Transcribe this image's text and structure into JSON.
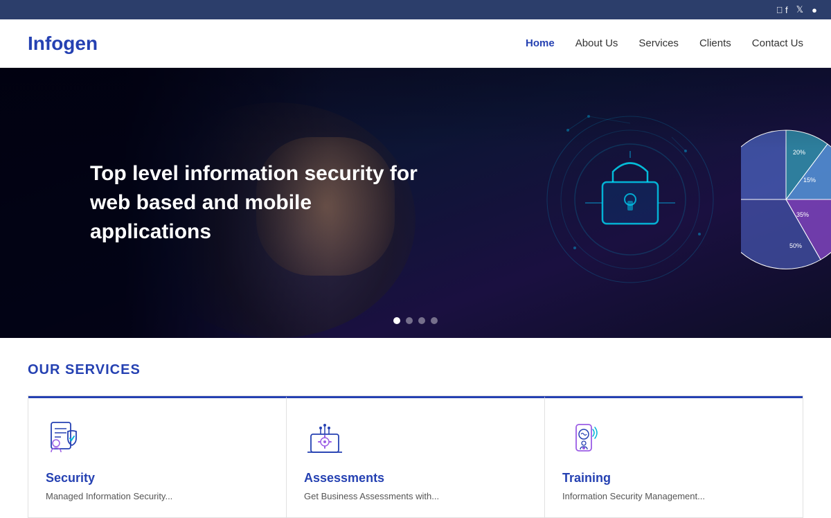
{
  "topbar": {
    "social_icons": [
      "facebook",
      "twitter",
      "instagram"
    ]
  },
  "header": {
    "logo": "Infogen",
    "nav_items": [
      {
        "label": "Home",
        "active": true
      },
      {
        "label": "About Us",
        "active": false
      },
      {
        "label": "Services",
        "active": false
      },
      {
        "label": "Clients",
        "active": false
      },
      {
        "label": "Contact Us",
        "active": false
      }
    ]
  },
  "hero": {
    "headline": "Top level information security for web based and mobile applications",
    "dots": [
      1,
      2,
      3,
      4
    ],
    "active_dot": 1
  },
  "services": {
    "section_title": "OUR SERVICES",
    "cards": [
      {
        "name": "Security",
        "description": "Managed Information Security..."
      },
      {
        "name": "Assessments",
        "description": "Get Business Assessments with..."
      },
      {
        "name": "Training",
        "description": "Information Security Management..."
      }
    ]
  }
}
